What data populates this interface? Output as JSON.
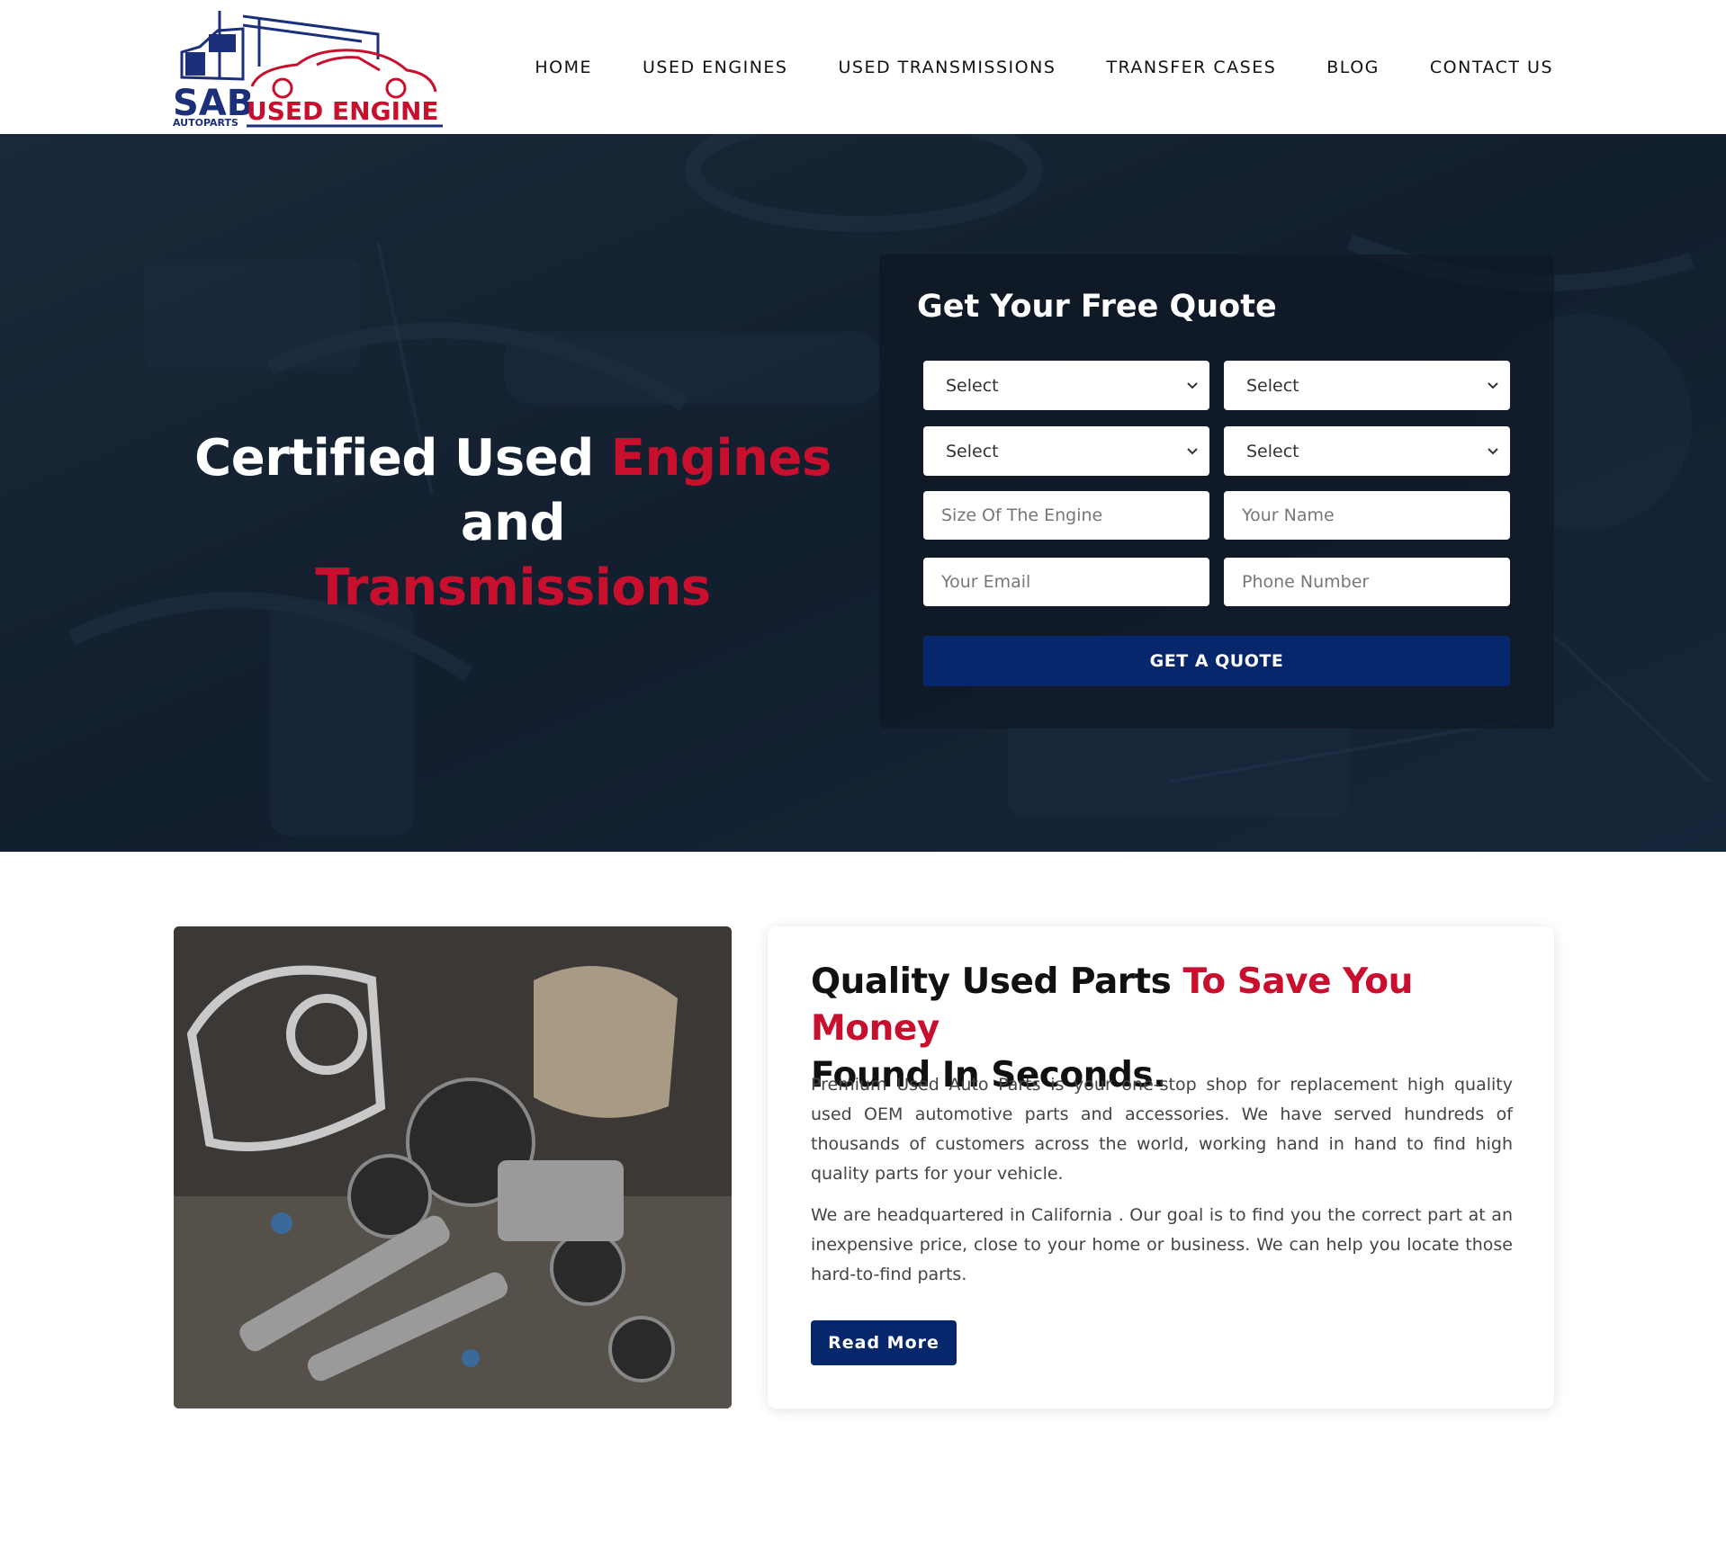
{
  "brand": {
    "logo_text_main": "SAB",
    "logo_text_sub": "AUTOPARTS",
    "logo_text_used": "USED ENGINE",
    "colors": {
      "navy": "#06276b",
      "red": "#c8102e"
    }
  },
  "nav": {
    "items": [
      {
        "label": "HOME"
      },
      {
        "label": "USED ENGINES"
      },
      {
        "label": "USED TRANSMISSIONS"
      },
      {
        "label": "TRANSFER CASES"
      },
      {
        "label": "BLOG"
      },
      {
        "label": "CONTACT US"
      }
    ]
  },
  "hero": {
    "title_part1": "Certified Used ",
    "title_highlight1": "Engines",
    "title_part2": " and",
    "title_highlight2": "Transmissions"
  },
  "quote_form": {
    "title": "Get Your Free Quote",
    "selects": [
      {
        "value": "Select"
      },
      {
        "value": "Select"
      },
      {
        "value": "Select"
      },
      {
        "value": "Select"
      }
    ],
    "inputs": [
      {
        "placeholder": "Size Of The Engine"
      },
      {
        "placeholder": "Your Name"
      },
      {
        "placeholder": "Your Email"
      },
      {
        "placeholder": "Phone Number"
      }
    ],
    "submit_label": "GET A QUOTE"
  },
  "about": {
    "title_part1": "Quality Used Parts ",
    "title_highlight": "To Save You Money",
    "title_part2": "Found In Seconds.",
    "paragraph1": "Premium Used Auto Parts is your one-stop shop for replacement high quality used OEM automotive parts and accessories. We have served hundreds of thousands of customers across the world, working hand in hand to find high quality parts for your vehicle.",
    "paragraph2": "We are headquartered in California . Our goal is to find you the correct part at an inexpensive price, close to your home or business. We can help you locate those hard-to-find parts.",
    "button_label": "Read More"
  }
}
